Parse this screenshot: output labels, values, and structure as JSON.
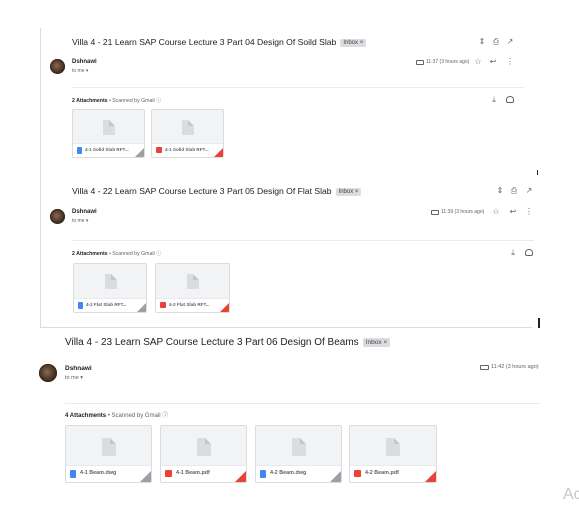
{
  "emails": [
    {
      "subject": "Villa 4 - 21 Learn SAP Course Lecture 3 Part 04 Design Of Soild Slab",
      "badge": "Inbox ×",
      "sender": "Dshnawi",
      "to": "to me ▾",
      "time": "11:37 (3 hours ago)",
      "attachments_header": "2 Attachments",
      "scanned": " • Scanned by Gmail ⓘ",
      "attachments": [
        {
          "name": "4-1 Solid Slab RFT...",
          "kind": "doc"
        },
        {
          "name": "4-1 Solid Slab RFT...",
          "kind": "pdf"
        }
      ]
    },
    {
      "subject": "Villa 4 - 22 Learn SAP Course Lecture 3 Part 05 Design Of Flat Slab",
      "badge": "Inbox ×",
      "sender": "Dshnawi",
      "to": "to me ▾",
      "time": "11:39 (3 hours ago)",
      "attachments_header": "2 Attachments",
      "scanned": " • Scanned by Gmail ⓘ",
      "attachments": [
        {
          "name": "4-2 Flat Slab RFT...",
          "kind": "doc"
        },
        {
          "name": "4-2 Flat Slab RFT...",
          "kind": "pdf"
        }
      ]
    },
    {
      "subject": "Villa 4 - 23 Learn SAP Course Lecture 3 Part 06 Design Of Beams",
      "badge": "Inbox ×",
      "sender": "Dshnawi",
      "to": "to me ▾",
      "time": "11:42 (3 hours ago)",
      "attachments_header": "4 Attachments",
      "scanned": " • Scanned by Gmail ⓘ",
      "attachments": [
        {
          "name": "4-1 Beam.dwg",
          "kind": "doc"
        },
        {
          "name": "4-1 Beam.pdf",
          "kind": "pdf"
        },
        {
          "name": "4-2 Beam.dwg",
          "kind": "doc"
        },
        {
          "name": "4-2 Beam.pdf",
          "kind": "pdf"
        }
      ]
    }
  ],
  "icons": {
    "expand": "⇕",
    "print": "⎙",
    "popout": "↗",
    "label": "label-icon",
    "star": "☆",
    "reply": "↩",
    "more": "⋮",
    "download": "⤓",
    "drive": "drive-icon"
  },
  "corner_text": "Ac",
  "colors": {
    "doc_icon": "#4285f4",
    "pdf_icon": "#ea4335"
  }
}
